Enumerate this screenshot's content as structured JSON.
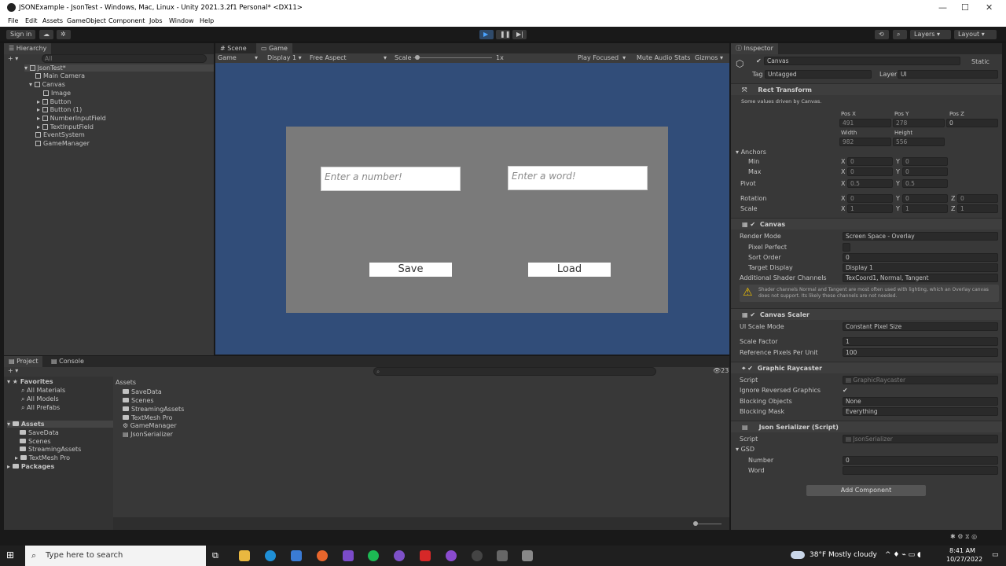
{
  "window": {
    "title": "JSONExample - JsonTest - Windows, Mac, Linux - Unity 2021.3.2f1 Personal* <DX11>",
    "min": "—",
    "max": "☐",
    "close": "✕"
  },
  "menu": [
    "File",
    "Edit",
    "Assets",
    "GameObject",
    "Component",
    "Jobs",
    "Window",
    "Help"
  ],
  "toolbar": {
    "sign_in": "Sign in",
    "layers": "Layers",
    "layout": "Layout"
  },
  "hierarchy": {
    "tab": "Hierarchy",
    "search_placeholder": "All",
    "scene": "JsonTest*",
    "items": [
      "Main Camera",
      "Canvas",
      "Image",
      "Button",
      "Button (1)",
      "NumberInputField",
      "TextInputField",
      "EventSystem",
      "GameManager"
    ]
  },
  "scene_tabs": {
    "scene": "Scene",
    "game": "Game"
  },
  "game_bar": {
    "mode": "Game",
    "display": "Display 1",
    "aspect": "Free Aspect",
    "scale_label": "Scale",
    "scale_value": "1x",
    "play_focused": "Play Focused",
    "mute": "Mute Audio",
    "stats": "Stats",
    "gizmos": "Gizmos"
  },
  "game": {
    "number_placeholder": "Enter a number!",
    "word_placeholder": "Enter a word!",
    "save": "Save",
    "load": "Load"
  },
  "project": {
    "tab_project": "Project",
    "tab_console": "Console",
    "count": "23",
    "favorites": "Favorites",
    "fav_items": [
      "All Materials",
      "All Models",
      "All Prefabs"
    ],
    "assets": "Assets",
    "asset_tree": [
      "SaveData",
      "Scenes",
      "StreamingAssets",
      "TextMesh Pro"
    ],
    "packages": "Packages",
    "breadcrumb": "Assets",
    "files": [
      "SaveData",
      "Scenes",
      "StreamingAssets",
      "TextMesh Pro",
      "GameManager",
      "JsonSerializer"
    ]
  },
  "inspector": {
    "tab": "Inspector",
    "object": "Canvas",
    "static": "Static",
    "tag_label": "Tag",
    "tag": "Untagged",
    "layer_label": "Layer",
    "layer": "UI",
    "rect": {
      "title": "Rect Transform",
      "note": "Some values driven by Canvas.",
      "posx_l": "Pos X",
      "posy_l": "Pos Y",
      "posz_l": "Pos Z",
      "posx": "491",
      "posy": "278",
      "posz": "0",
      "width_l": "Width",
      "height_l": "Height",
      "width": "982",
      "height": "556",
      "anchors": "Anchors",
      "min": "Min",
      "max": "Max",
      "pivot": "Pivot",
      "rotation": "Rotation",
      "scale": "Scale",
      "min_x": "0",
      "min_y": "0",
      "max_x": "0",
      "max_y": "0",
      "pivot_x": "0.5",
      "pivot_y": "0.5",
      "rot_x": "0",
      "rot_y": "0",
      "rot_z": "0",
      "sc_x": "1",
      "sc_y": "1",
      "sc_z": "1",
      "x": "X",
      "y": "Y",
      "z": "Z"
    },
    "canvas": {
      "title": "Canvas",
      "render_mode_l": "Render Mode",
      "render_mode": "Screen Space - Overlay",
      "pixel_perfect": "Pixel Perfect",
      "sort_order_l": "Sort Order",
      "sort_order": "0",
      "target_display_l": "Target Display",
      "target_display": "Display 1",
      "shader_l": "Additional Shader Channels",
      "shader": "TexCoord1, Normal, Tangent",
      "warning": "Shader channels Normal and Tangent are most often used with lighting, which an Overlay canvas does not support. Its likely these channels are not needed."
    },
    "scaler": {
      "title": "Canvas Scaler",
      "mode_l": "UI Scale Mode",
      "mode": "Constant Pixel Size",
      "factor_l": "Scale Factor",
      "factor": "1",
      "rppu_l": "Reference Pixels Per Unit",
      "rppu": "100"
    },
    "raycaster": {
      "title": "Graphic Raycaster",
      "script_l": "Script",
      "script": "GraphicRaycaster",
      "ignore_l": "Ignore Reversed Graphics",
      "blocking_l": "Blocking Objects",
      "blocking": "None",
      "mask_l": "Blocking Mask",
      "mask": "Everything"
    },
    "json": {
      "title": "Json Serializer (Script)",
      "script_l": "Script",
      "script": "JsonSerializer",
      "gsd": "GSD",
      "number_l": "Number",
      "number": "0",
      "word_l": "Word",
      "word": ""
    },
    "add_component": "Add Component"
  },
  "taskbar": {
    "search": "Type here to search",
    "weather": "38°F  Mostly cloudy",
    "time": "8:41 AM",
    "date": "10/27/2022"
  }
}
